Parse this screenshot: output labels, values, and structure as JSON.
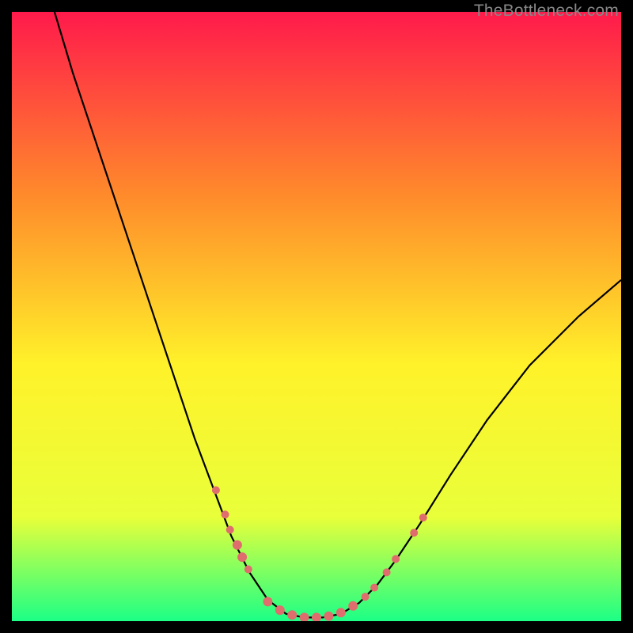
{
  "watermark": "TheBottleneck.com",
  "chart_data": {
    "type": "line",
    "title": "",
    "xlabel": "",
    "ylabel": "",
    "xlim": [
      0,
      100
    ],
    "ylim": [
      0,
      100
    ],
    "background_gradient": {
      "top": "#ff1a4b",
      "upper_mid": "#ff8a2b",
      "mid": "#fff22a",
      "lower_mid": "#e8ff3a",
      "bottom": "#1cff86"
    },
    "curve": {
      "name": "bottleneck-curve",
      "points": [
        {
          "x": 7.0,
          "y": 100.0
        },
        {
          "x": 10.0,
          "y": 90.0
        },
        {
          "x": 14.0,
          "y": 78.0
        },
        {
          "x": 18.0,
          "y": 66.0
        },
        {
          "x": 22.0,
          "y": 54.0
        },
        {
          "x": 26.0,
          "y": 42.0
        },
        {
          "x": 30.0,
          "y": 30.0
        },
        {
          "x": 33.0,
          "y": 22.0
        },
        {
          "x": 36.0,
          "y": 14.0
        },
        {
          "x": 39.0,
          "y": 8.0
        },
        {
          "x": 42.0,
          "y": 3.5
        },
        {
          "x": 45.0,
          "y": 1.2
        },
        {
          "x": 48.0,
          "y": 0.6
        },
        {
          "x": 51.0,
          "y": 0.6
        },
        {
          "x": 54.0,
          "y": 1.2
        },
        {
          "x": 57.0,
          "y": 3.0
        },
        {
          "x": 60.0,
          "y": 6.0
        },
        {
          "x": 63.0,
          "y": 10.0
        },
        {
          "x": 67.0,
          "y": 16.0
        },
        {
          "x": 72.0,
          "y": 24.0
        },
        {
          "x": 78.0,
          "y": 33.0
        },
        {
          "x": 85.0,
          "y": 42.0
        },
        {
          "x": 93.0,
          "y": 50.0
        },
        {
          "x": 100.0,
          "y": 56.0
        }
      ]
    },
    "markers": {
      "name": "highlight-points",
      "color": "#e06d6d",
      "points": [
        {
          "x": 33.5,
          "y": 21.5,
          "r": 5
        },
        {
          "x": 35.0,
          "y": 17.5,
          "r": 5
        },
        {
          "x": 35.8,
          "y": 15.0,
          "r": 5
        },
        {
          "x": 37.0,
          "y": 12.5,
          "r": 6
        },
        {
          "x": 37.8,
          "y": 10.5,
          "r": 6
        },
        {
          "x": 38.8,
          "y": 8.5,
          "r": 5
        },
        {
          "x": 42.0,
          "y": 3.2,
          "r": 6
        },
        {
          "x": 44.0,
          "y": 1.8,
          "r": 6
        },
        {
          "x": 46.0,
          "y": 1.0,
          "r": 6
        },
        {
          "x": 48.0,
          "y": 0.6,
          "r": 6
        },
        {
          "x": 50.0,
          "y": 0.6,
          "r": 6
        },
        {
          "x": 52.0,
          "y": 0.8,
          "r": 6
        },
        {
          "x": 54.0,
          "y": 1.4,
          "r": 6
        },
        {
          "x": 56.0,
          "y": 2.5,
          "r": 6
        },
        {
          "x": 58.0,
          "y": 4.0,
          "r": 5
        },
        {
          "x": 59.5,
          "y": 5.5,
          "r": 5
        },
        {
          "x": 61.5,
          "y": 8.0,
          "r": 5
        },
        {
          "x": 63.0,
          "y": 10.2,
          "r": 5
        },
        {
          "x": 66.0,
          "y": 14.5,
          "r": 5
        },
        {
          "x": 67.5,
          "y": 17.0,
          "r": 5
        }
      ]
    }
  }
}
